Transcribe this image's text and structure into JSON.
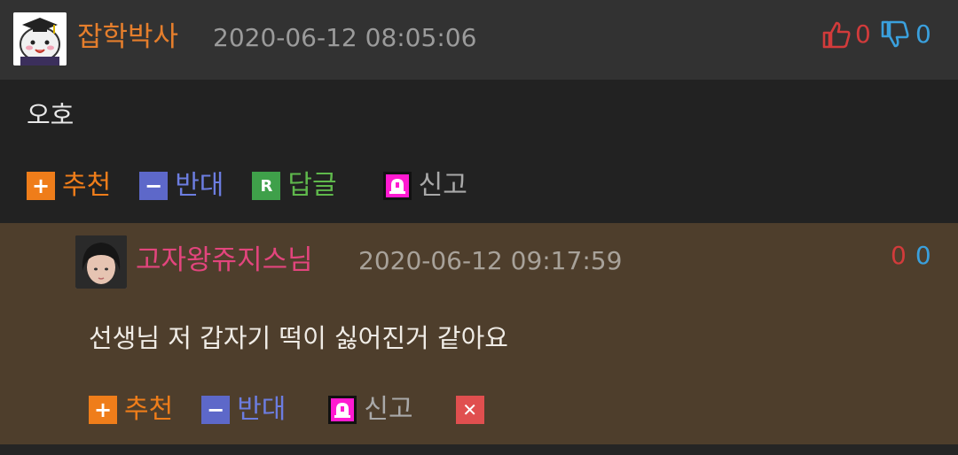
{
  "comment": {
    "author": "잡학박사",
    "timestamp": "2020-06-12 08:05:06",
    "up_votes": "0",
    "down_votes": "0",
    "text": "오호",
    "actions": {
      "recommend": "추천",
      "oppose": "반대",
      "reply": "답글",
      "report": "신고"
    },
    "icons": {
      "plus": "+",
      "minus": "−",
      "reply": "R"
    }
  },
  "reply": {
    "author": "고자왕쥬지스님",
    "timestamp": "2020-06-12 09:17:59",
    "up_votes": "0",
    "down_votes": "0",
    "text": "선생님 저 갑자기 떡이 싫어진거 같아요",
    "actions": {
      "recommend": "추천",
      "oppose": "반대",
      "report": "신고"
    },
    "icons": {
      "plus": "+",
      "minus": "−",
      "delete": "✕"
    }
  },
  "colors": {
    "header_bg": "#323232",
    "reply_bg": "#4e3e2c",
    "author1": "#e57e2c",
    "author2": "#e2457d",
    "up": "#d23b3b",
    "down": "#3aa0dd"
  }
}
